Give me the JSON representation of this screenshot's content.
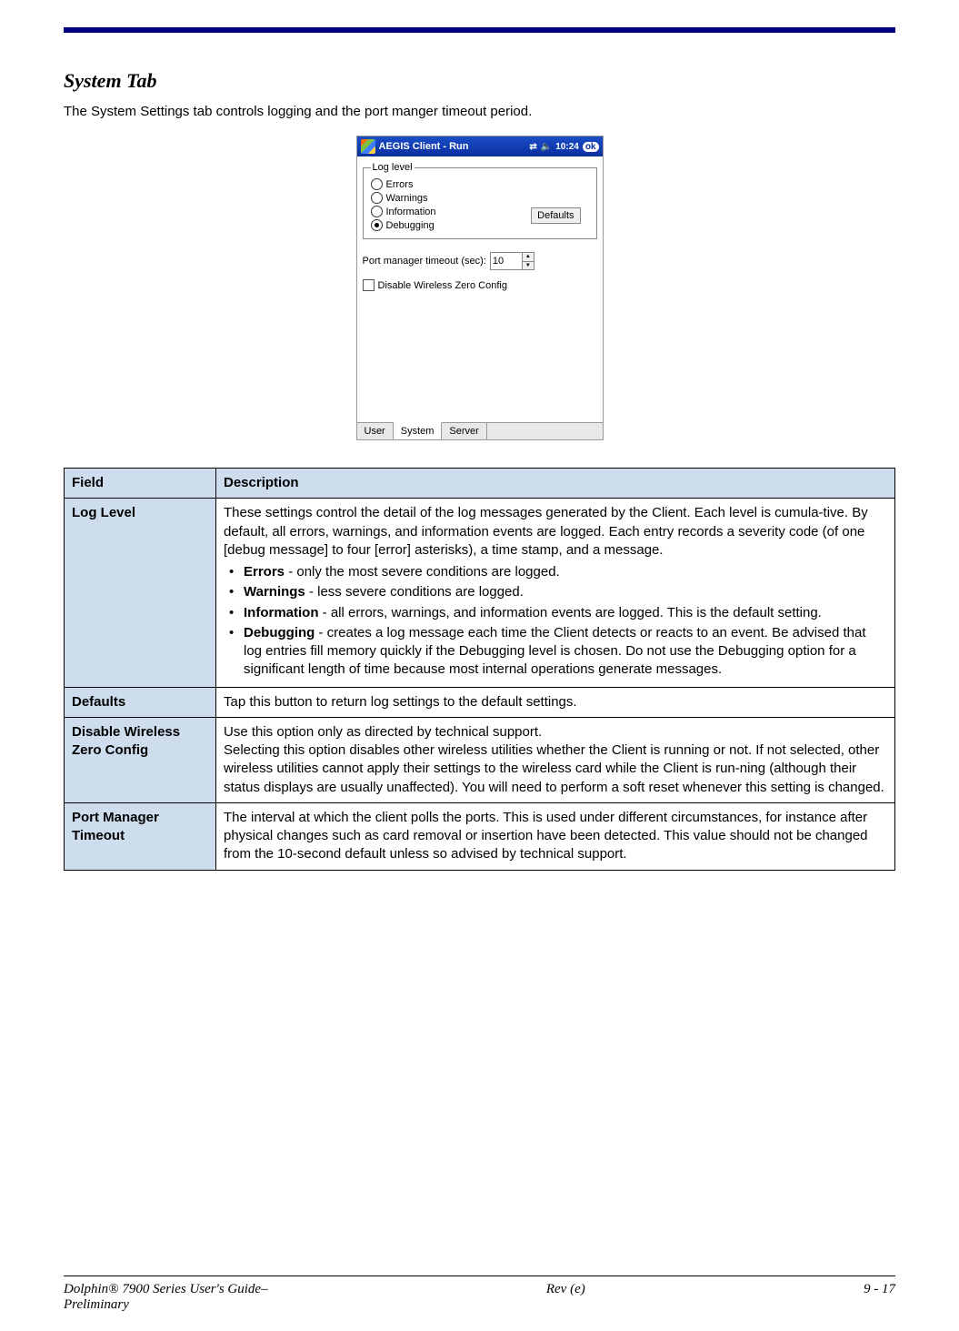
{
  "section_title": "System Tab",
  "intro": "The System Settings tab controls logging and the port manger timeout period.",
  "screenshot": {
    "window_title": "AEGIS Client - Run",
    "time": "10:24",
    "ok_label": "ok",
    "log_level_legend": "Log level",
    "radios": {
      "errors": "Errors",
      "warnings": "Warnings",
      "information": "Information",
      "debugging": "Debugging",
      "selected": "debugging"
    },
    "defaults_button": "Defaults",
    "port_manager_label": "Port manager timeout (sec):",
    "port_manager_value": "10",
    "disable_wireless_label": "Disable Wireless Zero Config",
    "tabs": {
      "user": "User",
      "system": "System",
      "server": "Server",
      "active": "system"
    }
  },
  "table": {
    "header_field": "Field",
    "header_desc": "Description",
    "rows": {
      "log_level": {
        "field": "Log Level",
        "intro": "These settings control the detail of the log messages generated by the Client. Each level is cumula-tive. By default, all errors, warnings, and information events are logged. Each entry records a severity code (of one [debug message] to four [error] asterisks), a time stamp, and a message.",
        "bullets": {
          "errors": {
            "bold": "Errors",
            "text": " - only the most severe conditions are logged."
          },
          "warnings": {
            "bold": "Warnings",
            "text": " - less severe conditions are logged."
          },
          "information": {
            "bold": "Information",
            "text": " - all errors, warnings, and information events are logged. This is the default setting."
          },
          "debugging": {
            "bold": "Debugging",
            "text": " - creates a log message each time the Client detects or reacts to an event. Be advised that log entries fill memory quickly if the Debugging level is chosen. Do not use the Debugging option for a significant length of time because most internal operations generate messages."
          }
        }
      },
      "defaults": {
        "field": "Defaults",
        "text": "Tap this button to return log settings to the default settings."
      },
      "disable_wireless": {
        "field": "Disable Wireless Zero Config",
        "line1": "Use this option only as directed by technical support.",
        "line2": "Selecting this option disables other wireless utilities whether the Client is running or not. If not selected, other wireless utilities cannot apply their settings to the wireless card while the Client is run-ning (although their status displays are usually unaffected).   You will need to perform a soft reset whenever this setting is changed."
      },
      "port_manager": {
        "field": "Port Manager Timeout",
        "text": "The interval at which the client polls the ports. This is used under different circumstances, for instance after physical changes such as card removal or insertion have been detected. This value should not be changed from the 10-second default unless so advised by technical support."
      }
    }
  },
  "footer": {
    "left_line1": "Dolphin® 7900 Series User's Guide–",
    "left_line2": "Preliminary",
    "center": "Rev (e)",
    "right": "9 - 17"
  }
}
